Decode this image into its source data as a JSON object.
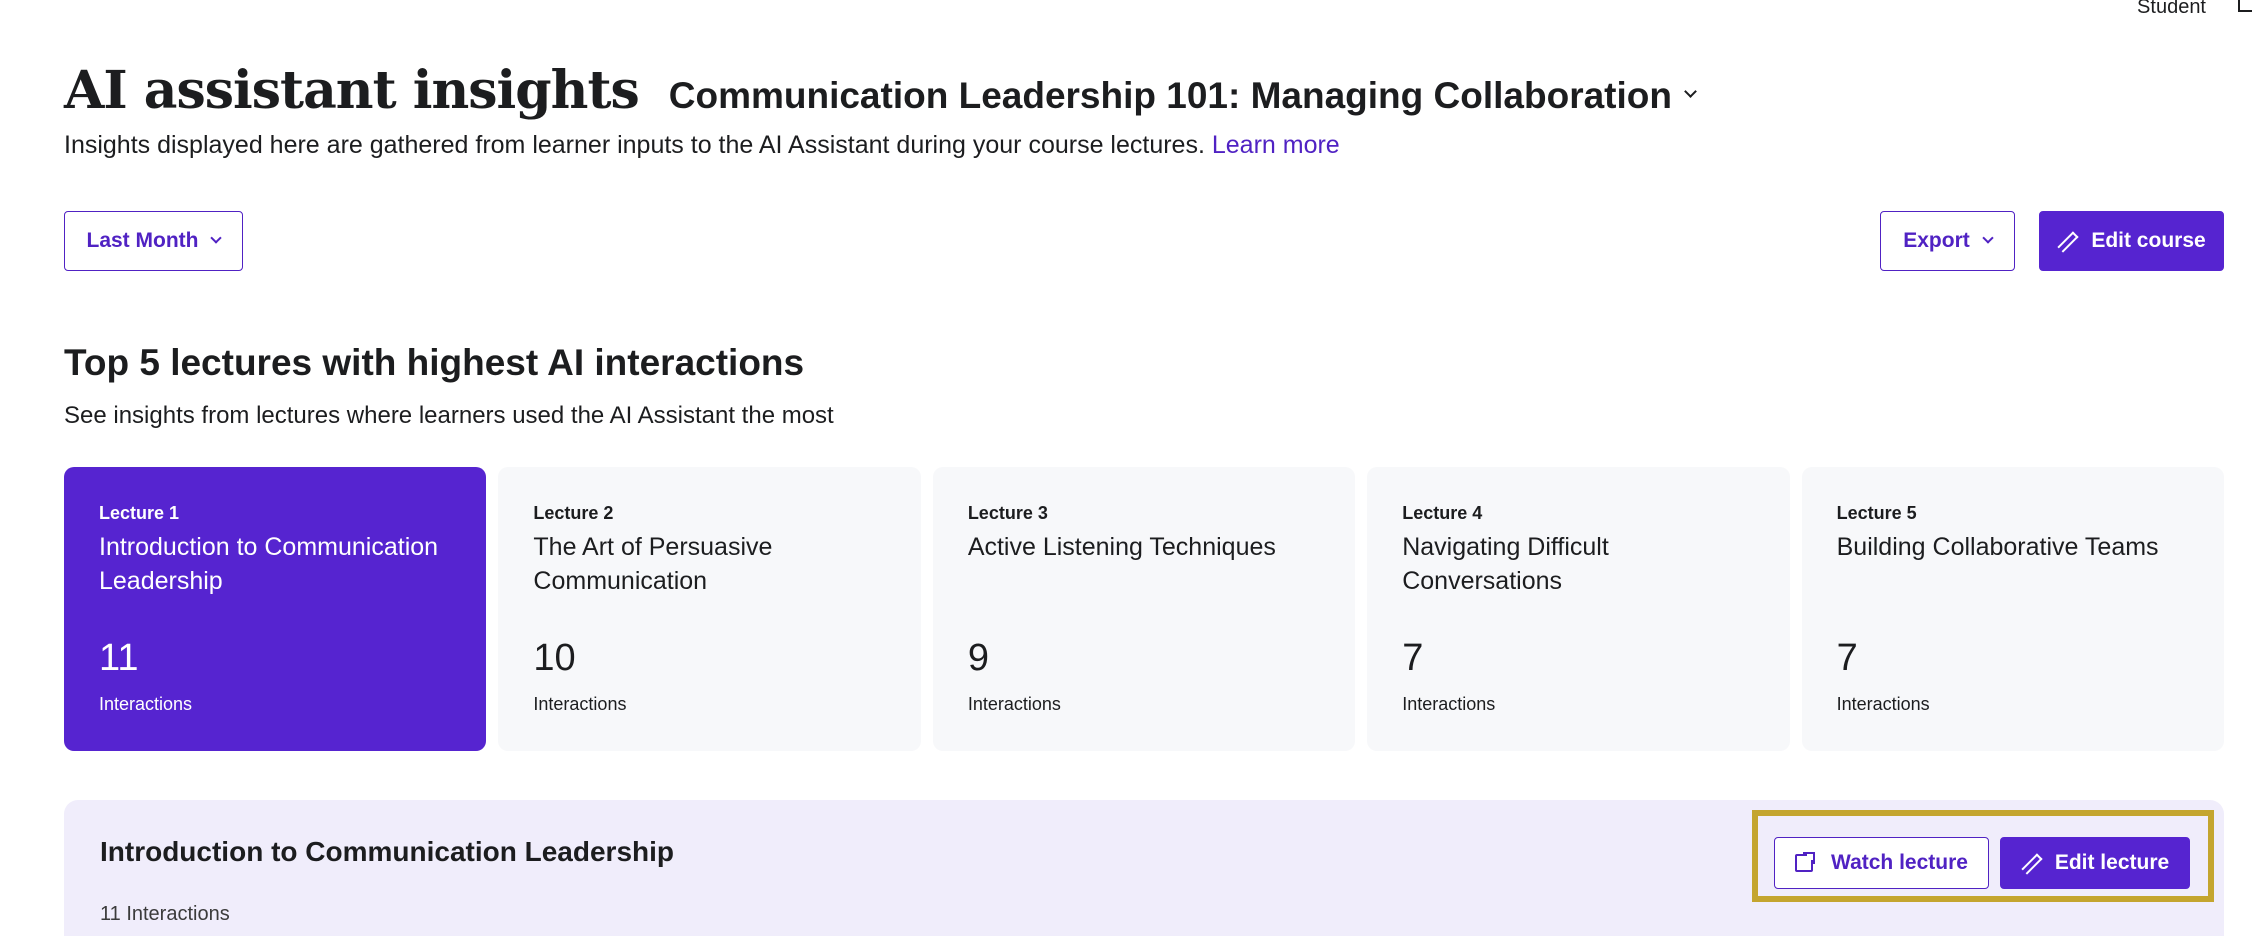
{
  "top": {
    "user_label": "Student"
  },
  "header": {
    "title": "AI assistant insights",
    "course_name": "Communication Leadership 101: Managing Collaboration",
    "subtitle": "Insights displayed here are gathered from learner inputs to the AI Assistant during your course lectures.",
    "learn_more": "Learn more"
  },
  "toolbar": {
    "period_label": "Last Month",
    "export_label": "Export",
    "edit_course_label": "Edit course"
  },
  "colors": {
    "accent": "#5624d0",
    "highlight": "#c4a52f",
    "card_bg": "#f7f8fa",
    "detail_bg": "#f0edfb"
  },
  "top_lectures": {
    "title": "Top 5 lectures with highest AI interactions",
    "subtitle": "See insights from lectures where learners used the AI Assistant the most",
    "cards": [
      {
        "lecture": "Lecture 1",
        "title": "Introduction to Communication Leadership",
        "count": "11",
        "label": "Interactions"
      },
      {
        "lecture": "Lecture 2",
        "title": "The Art of Persuasive Communication",
        "count": "10",
        "label": "Interactions"
      },
      {
        "lecture": "Lecture 3",
        "title": "Active Listening Techniques",
        "count": "9",
        "label": "Interactions"
      },
      {
        "lecture": "Lecture 4",
        "title": "Navigating Difficult Conversations",
        "count": "7",
        "label": "Interactions"
      },
      {
        "lecture": "Lecture 5",
        "title": "Building Collaborative Teams",
        "count": "7",
        "label": "Interactions"
      }
    ]
  },
  "detail": {
    "title": "Introduction to Communication Leadership",
    "count": "11 Interactions",
    "watch_label": "Watch lecture",
    "edit_label": "Edit lecture"
  }
}
